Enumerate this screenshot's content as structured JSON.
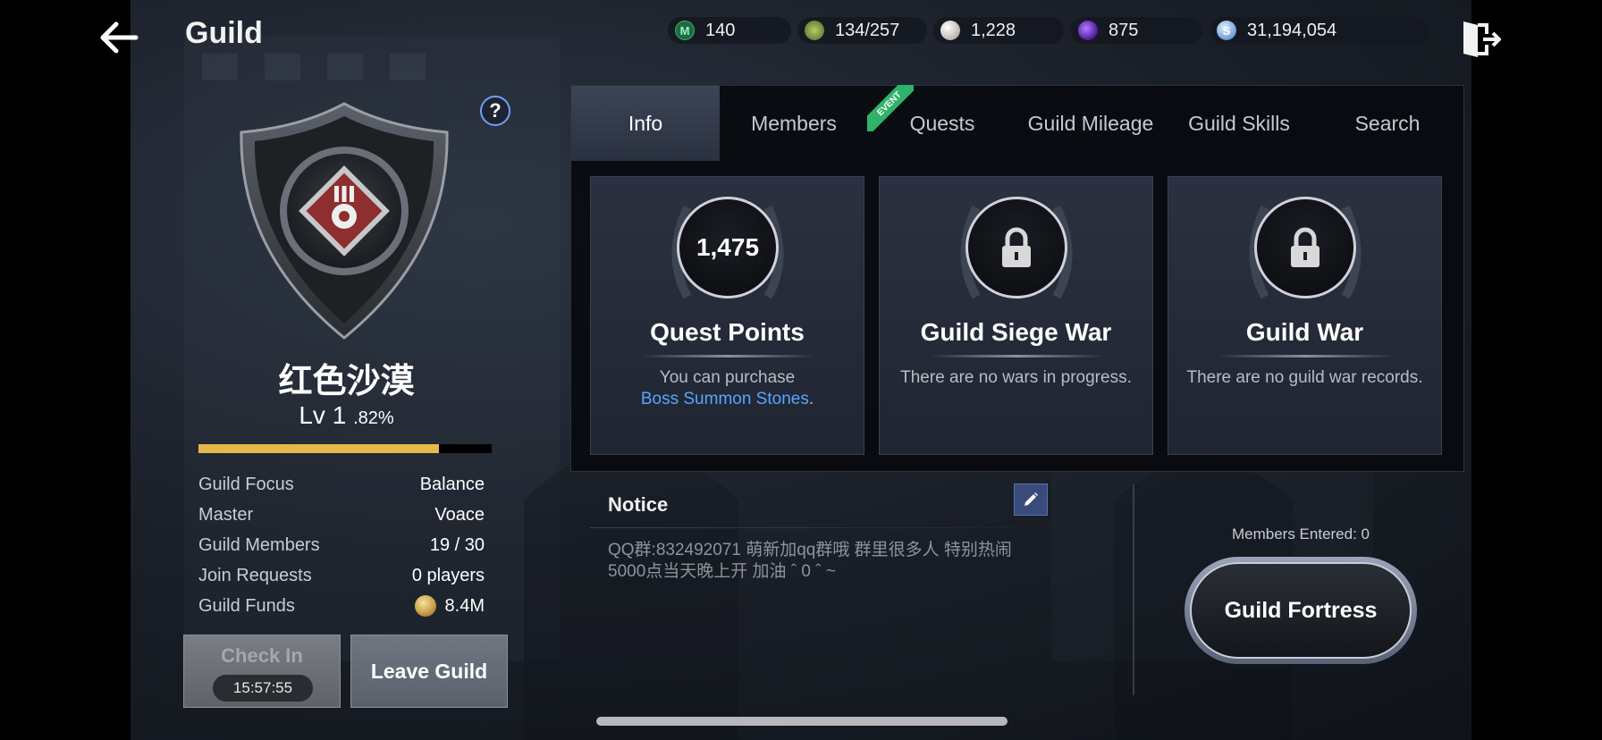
{
  "header": {
    "title": "Guild",
    "currencies": [
      {
        "icon": "mileage-icon",
        "symbol": "M",
        "value": "140",
        "color": "#2fb36a"
      },
      {
        "icon": "stamina-icon",
        "symbol": "",
        "value": "134/257",
        "color": "#7a9a3a"
      },
      {
        "icon": "pearl-icon",
        "symbol": "",
        "value": "1,228",
        "color": "#e6e2dc"
      },
      {
        "icon": "dark-orb-icon",
        "symbol": "",
        "value": "875",
        "color": "#6a2fc9"
      },
      {
        "icon": "silver-icon",
        "symbol": "S",
        "value": "31,194,054",
        "color": "#8fb6e8"
      }
    ]
  },
  "guild": {
    "name": "红色沙漠",
    "level": "Lv 1",
    "level_pct": ".82%",
    "xp_fraction": 0.82,
    "stats": [
      {
        "key": "Guild Focus",
        "value": "Balance"
      },
      {
        "key": "Master",
        "value": "Voace"
      },
      {
        "key": "Guild Members",
        "value": "19 / 30"
      },
      {
        "key": "Join Requests",
        "value": "0 players"
      },
      {
        "key": "Guild Funds",
        "value": "8.4M"
      }
    ],
    "checkin_label": "Check In",
    "checkin_timer": "15:57:55",
    "leave_label": "Leave Guild"
  },
  "tabs": [
    {
      "label": "Info",
      "active": true
    },
    {
      "label": "Members",
      "active": false
    },
    {
      "label": "Quests",
      "active": false,
      "badge": "EVENT"
    },
    {
      "label": "Guild Mileage",
      "active": false
    },
    {
      "label": "Guild Skills",
      "active": false
    },
    {
      "label": "Search",
      "active": false
    }
  ],
  "cards": [
    {
      "title": "Quest Points",
      "value": "1,475",
      "desc_prefix": "You can purchase",
      "desc_link": "Boss Summon Stones",
      "desc_suffix": "."
    },
    {
      "title": "Guild Siege War",
      "desc": "There are no wars in progress."
    },
    {
      "title": "Guild War",
      "desc": "There are no guild war records."
    }
  ],
  "notice": {
    "title": "Notice",
    "text_line1": "QQ群:832492071 萌新加qq群哦 群里很多人 特别热闹",
    "text_line2": "5000点当天晚上开 加油 ˆ 0 ˆ ~"
  },
  "fortress": {
    "members_entered": "Members Entered: 0",
    "button_label": "Guild Fortress"
  }
}
